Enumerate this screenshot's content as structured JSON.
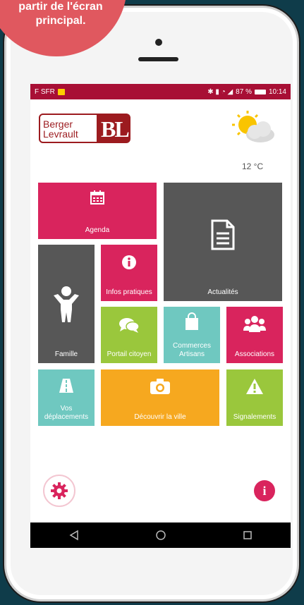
{
  "callout": {
    "text": "partir de l'écran\nprincipal."
  },
  "status_bar": {
    "carrier": "F SFR",
    "battery": "87 %",
    "time": "10:14"
  },
  "header": {
    "logo_text_line1": "Berger",
    "logo_text_line2": "Levrault",
    "logo_mark": "BL",
    "temperature": "12 °C"
  },
  "tiles": {
    "agenda": "Agenda",
    "actualites": "Actualités",
    "famille": "Famille",
    "infos": "Infos pratiques",
    "portail": "Portail citoyen",
    "commerces": "Commerces\nArtisans",
    "associations": "Associations",
    "deplacements": "Vos\ndéplacements",
    "decouvrir": "Découvrir la ville",
    "signalements": "Signalements"
  },
  "colors": {
    "pink": "#d9245d",
    "gray": "#575757",
    "green": "#9ac73c",
    "teal": "#6fc8c0",
    "orange": "#f6a81f",
    "status": "#a80f35"
  },
  "icons": {
    "settings": "gear-icon",
    "info": "info-icon"
  }
}
